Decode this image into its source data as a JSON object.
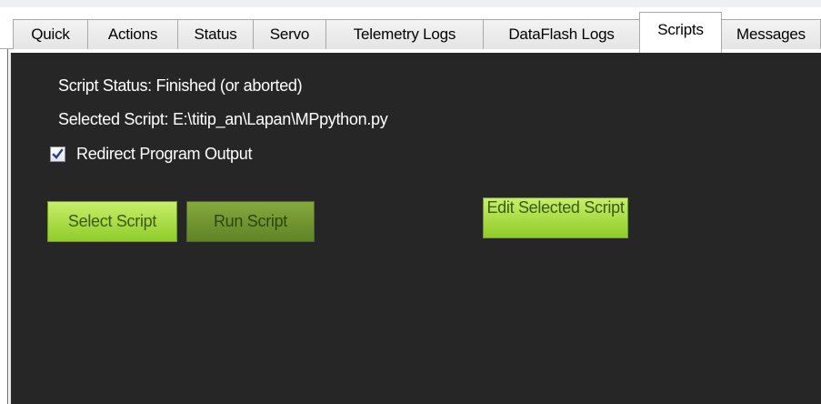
{
  "tabs": [
    {
      "label": "Quick",
      "active": false
    },
    {
      "label": "Actions",
      "active": false
    },
    {
      "label": "Status",
      "active": false
    },
    {
      "label": "Servo",
      "active": false
    },
    {
      "label": "Telemetry Logs",
      "active": false
    },
    {
      "label": "DataFlash Logs",
      "active": false
    },
    {
      "label": "Scripts",
      "active": true
    },
    {
      "label": "Messages",
      "active": false
    }
  ],
  "scripts_panel": {
    "script_status": "Script Status: Finished (or aborted)",
    "selected_script": "Selected Script: E:\\titip_an\\Lapan\\MPpython.py",
    "redirect_output": {
      "label": "Redirect Program Output",
      "checked": true
    },
    "buttons": {
      "select_script": "Select Script",
      "run_script": "Run Script",
      "edit_selected_script": "Edit Selected Script"
    }
  },
  "colors": {
    "panel_background": "#262626",
    "button_green": "#a6dc3f",
    "button_green_disabled": "#6e9630"
  }
}
